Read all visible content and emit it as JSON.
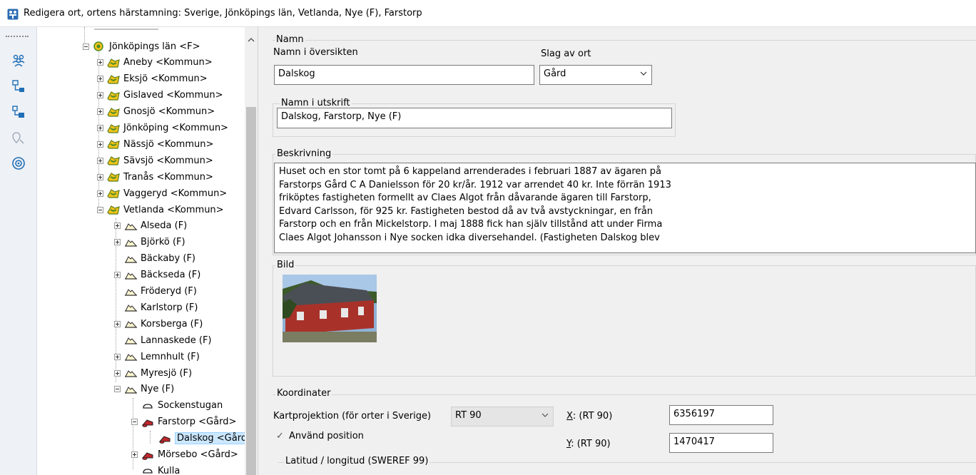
{
  "window": {
    "title": "Redigera ort, ortens härstamning: Sverige, Jönköpings län, Vetlanda, Nye (F), Farstorp"
  },
  "toolbar": {
    "icons": [
      "people-icon",
      "tree-structure-icon",
      "tree-branch-icon",
      "location-search-icon",
      "target-icon"
    ]
  },
  "tree": {
    "items": [
      {
        "label": "Jönköpings län <F>",
        "icon": "county-icon",
        "expander": "minus"
      },
      {
        "label": "Aneby <Kommun>",
        "icon": "municipality-icon",
        "expander": "plus"
      },
      {
        "label": "Eksjö <Kommun>",
        "icon": "municipality-icon",
        "expander": "plus"
      },
      {
        "label": "Gislaved <Kommun>",
        "icon": "municipality-icon",
        "expander": "plus"
      },
      {
        "label": "Gnosjö <Kommun>",
        "icon": "municipality-icon",
        "expander": "plus"
      },
      {
        "label": "Jönköping <Kommun>",
        "icon": "municipality-icon",
        "expander": "plus"
      },
      {
        "label": "Nässjö <Kommun>",
        "icon": "municipality-icon",
        "expander": "plus"
      },
      {
        "label": "Sävsjö <Kommun>",
        "icon": "municipality-icon",
        "expander": "plus"
      },
      {
        "label": "Tranås <Kommun>",
        "icon": "municipality-icon",
        "expander": "plus"
      },
      {
        "label": "Vaggeryd <Kommun>",
        "icon": "municipality-icon",
        "expander": "plus"
      },
      {
        "label": "Vetlanda <Kommun>",
        "icon": "municipality-icon",
        "expander": "minus"
      },
      {
        "label": "Alseda (F)",
        "icon": "parish-icon",
        "expander": "plus"
      },
      {
        "label": "Björkö (F)",
        "icon": "parish-icon",
        "expander": "plus"
      },
      {
        "label": "Bäckaby (F)",
        "icon": "parish-icon",
        "expander": "none"
      },
      {
        "label": "Bäckseda (F)",
        "icon": "parish-icon",
        "expander": "plus"
      },
      {
        "label": "Fröderyd (F)",
        "icon": "parish-icon",
        "expander": "none"
      },
      {
        "label": "Karlstorp (F)",
        "icon": "parish-icon",
        "expander": "none"
      },
      {
        "label": "Korsberga (F)",
        "icon": "parish-icon",
        "expander": "plus"
      },
      {
        "label": "Lannaskede (F)",
        "icon": "parish-icon",
        "expander": "none"
      },
      {
        "label": "Lemnhult (F)",
        "icon": "parish-icon",
        "expander": "plus"
      },
      {
        "label": "Myresjö (F)",
        "icon": "parish-icon",
        "expander": "plus"
      },
      {
        "label": "Nye (F)",
        "icon": "parish-icon",
        "expander": "minus"
      },
      {
        "label": "Sockenstugan",
        "icon": "place-icon",
        "expander": "none"
      },
      {
        "label": "Farstorp <Gård>",
        "icon": "farm-icon",
        "expander": "minus"
      },
      {
        "label": "Dalskog <Gård",
        "icon": "farm-icon",
        "expander": "none",
        "selected": true
      },
      {
        "label": "Mörsebo <Gård>",
        "icon": "farm-icon",
        "expander": "plus"
      },
      {
        "label": "Kulla",
        "icon": "place-icon",
        "expander": "none"
      }
    ]
  },
  "form": {
    "namn": {
      "legend": "Namn",
      "overview_label": "Namn i översikten",
      "overview_value": "Dalskog",
      "kind_label": "Slag av ort",
      "kind_value": "Gård",
      "print_legend": "Namn i utskrift",
      "print_value": "Dalskog, Farstorp, Nye (F)"
    },
    "beskrivning": {
      "legend": "Beskrivning",
      "lines": [
        "Huset och en stor tomt på 6 kappeland arrenderades i februari 1887 av ägaren på",
        "Farstorps Gård C A Danielsson för 20 kr/år. 1912 var arrendet 40 kr. Inte förrän 1913",
        "friköptes fastigheten formellt av Claes Algot från dåvarande ägaren till Farstorp,",
        "Edvard Carlsson, för 925 kr. Fastigheten bestod då av två avstyckningar, en från",
        "Farstorp och en från Mickelstorp. I maj 1888 fick han själv tillstånd att under Firma",
        "Claes Algot Johansson i Nye socken idka diversehandel. (Fastigheten Dalskog blev"
      ]
    },
    "bild": {
      "legend": "Bild",
      "image_name": "red-house-photo"
    },
    "koordinater": {
      "legend": "Koordinater",
      "projection_label": "Kartprojektion (för orter i Sverige)",
      "projection_value": "RT 90",
      "x_key": "X",
      "x_label": ": (RT 90)",
      "x_value": "6356197",
      "y_key": "Y",
      "y_label": ": (RT 90)",
      "y_value": "1470417",
      "use_position_label": "Använd position",
      "use_position_checked": true,
      "latlong_legend": "Latitud / longitud (SWEREF 99)"
    }
  },
  "colors": {
    "selection": "#cce8ff",
    "county_icon": "#4c8c2b",
    "municipality_icon": "#f2c318",
    "farm_icon": "#c0262c",
    "toolbar_icon": "#1f6fb5"
  }
}
